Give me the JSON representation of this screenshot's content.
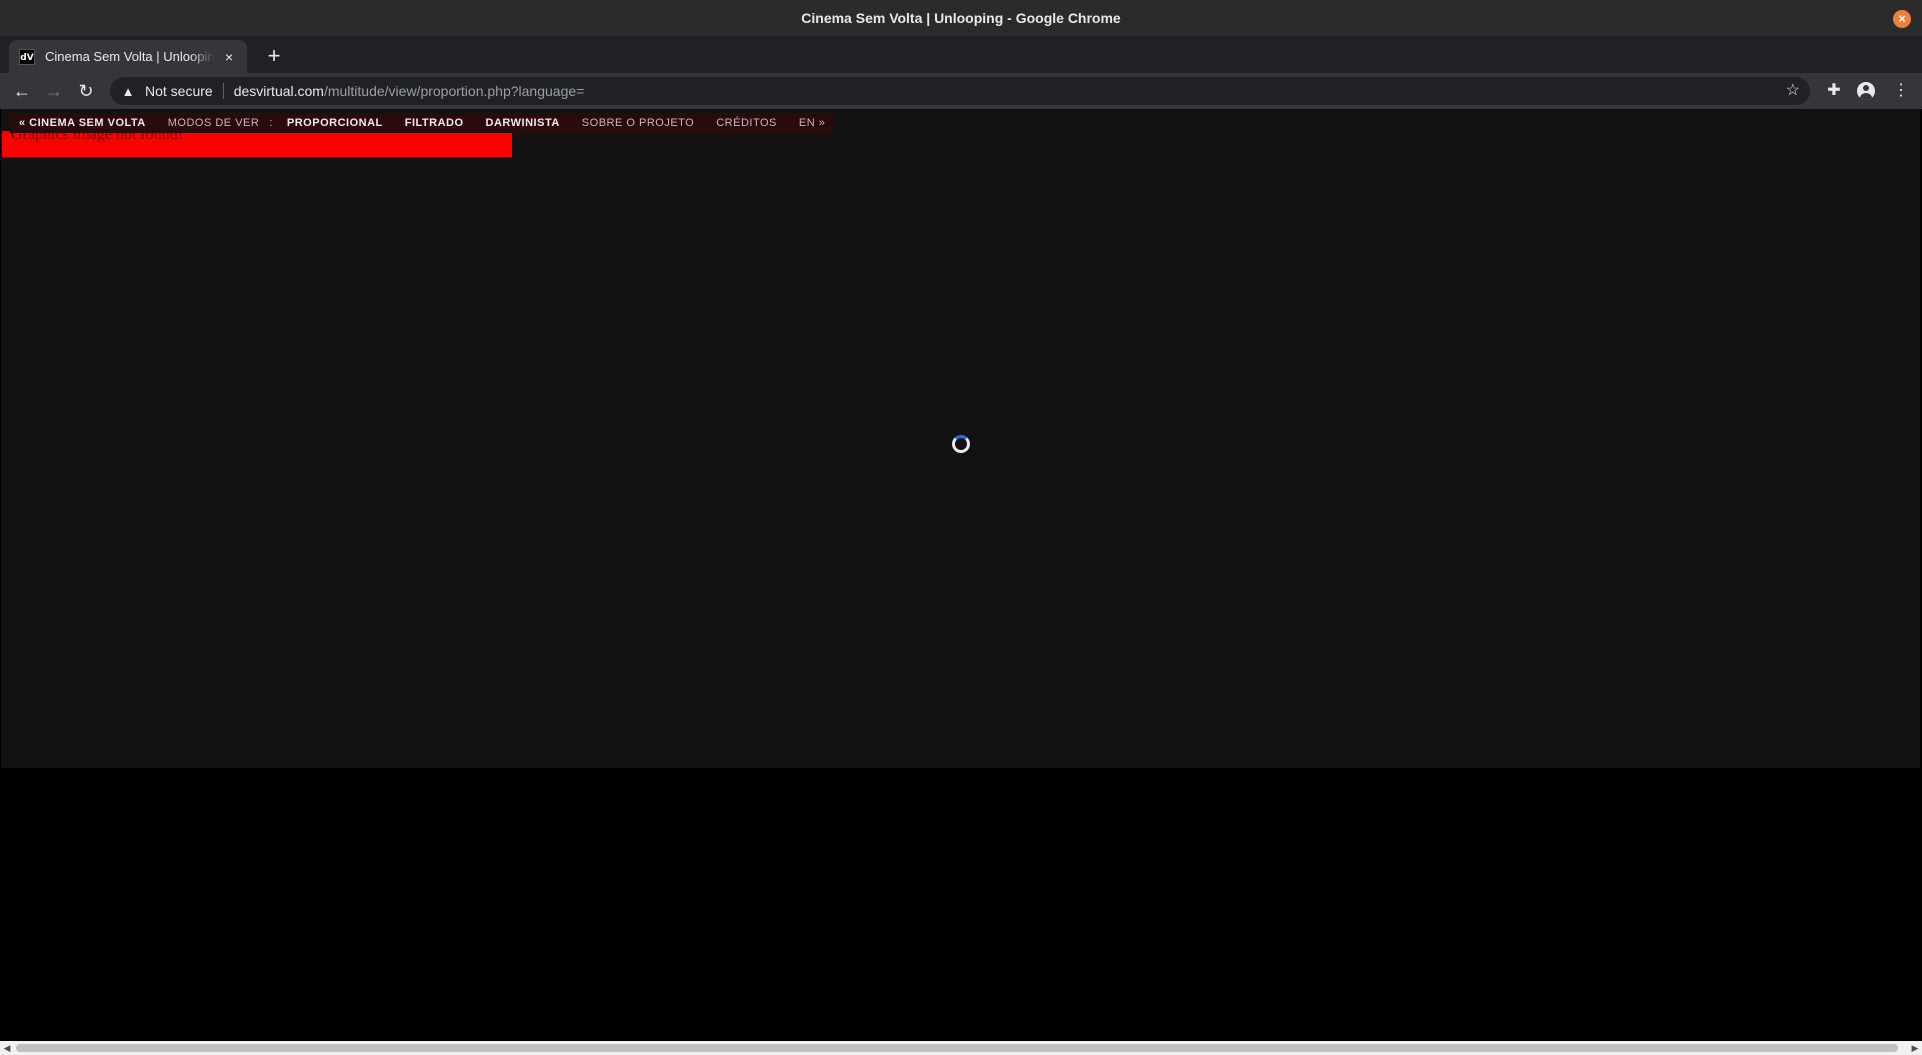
{
  "window": {
    "title": "Cinema Sem Volta | Unlooping - Google Chrome",
    "close_glyph": "×",
    "accent_color": "#f0803a"
  },
  "tab": {
    "favicon_text": "dV",
    "title": "Cinema Sem Volta | Unlooping",
    "close_glyph": "×",
    "new_tab_glyph": "+"
  },
  "toolbar": {
    "back_glyph": "←",
    "forward_glyph": "→",
    "reload_glyph": "↻",
    "warning_glyph": "▲",
    "security_label": "Not secure",
    "url_host": "desvirtual.com",
    "url_path": "/multitude/view/proportion.php?language=",
    "star_glyph": "☆",
    "extensions_glyph": "✚",
    "menu_glyph": "⋮"
  },
  "page": {
    "error_message": "Graphics image not found!",
    "nav": {
      "home": "« CINEMA SEM VOLTA",
      "modes_label": "MODOS DE VER",
      "separator": ":",
      "modes": [
        "PROPORCIONAL",
        "FILTRADO",
        "DARWINISTA"
      ],
      "about": "SOBRE O PROJETO",
      "credits": "CRÉDITOS",
      "language": "EN »"
    },
    "error_color": "#ff0000",
    "spinner_color": "#1a73e8"
  },
  "scrollbar": {
    "left_glyph": "◀",
    "right_glyph": "▶"
  }
}
